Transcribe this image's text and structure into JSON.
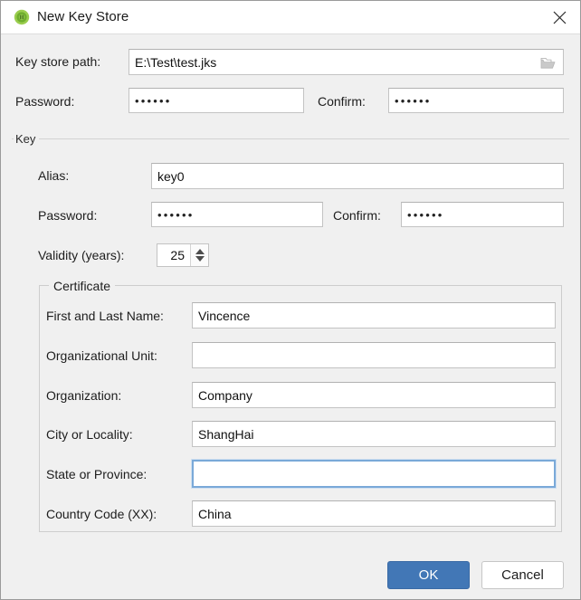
{
  "window": {
    "title": "New Key Store",
    "app_icon": "android-app-icon",
    "close_icon": "close-icon",
    "bg_color": "#f0f0f0",
    "titlebar_color": "#ffffff"
  },
  "keystore": {
    "path_label": "Key store path:",
    "path_value": "E:\\Test\\test.jks",
    "path_placeholder": "",
    "browse_icon": "folder-open-icon",
    "password_label": "Password:",
    "password_value": "••••••",
    "confirm_label": "Confirm:",
    "confirm_value": "••••••"
  },
  "key_group": {
    "title": "Key",
    "alias_label": "Alias:",
    "alias_value": "key0",
    "password_label": "Password:",
    "password_value": "••••••",
    "confirm_label": "Confirm:",
    "confirm_value": "••••••",
    "validity_label": "Validity (years):",
    "validity_value": "25",
    "spinner_up_icon": "arrow-up-icon",
    "spinner_down_icon": "arrow-down-icon"
  },
  "certificate": {
    "title": "Certificate",
    "fields": [
      {
        "label": "First and Last Name:",
        "value": "Vincence",
        "focused": false
      },
      {
        "label": "Organizational Unit:",
        "value": "",
        "focused": false
      },
      {
        "label": "Organization:",
        "value": "Company",
        "focused": false
      },
      {
        "label": "City or Locality:",
        "value": "ShangHai",
        "focused": false
      },
      {
        "label": "State or Province:",
        "value": "",
        "focused": true
      },
      {
        "label": "Country Code (XX):",
        "value": "China",
        "focused": false
      }
    ]
  },
  "footer": {
    "ok_label": "OK",
    "cancel_label": "Cancel",
    "ok_color": "#4277b6",
    "focus_border_color": "#7aa9d8"
  }
}
